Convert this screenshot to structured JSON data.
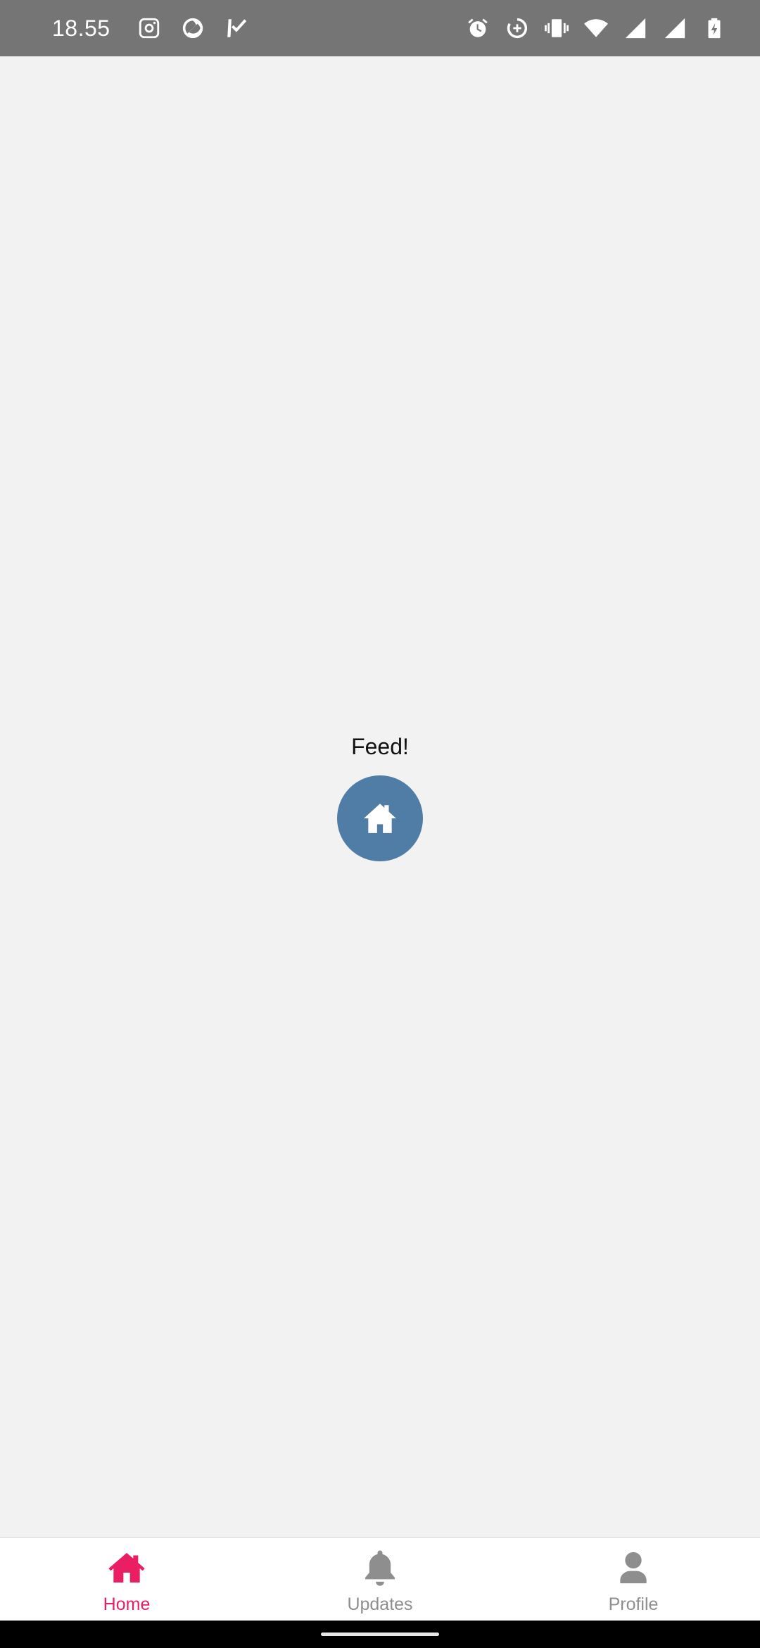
{
  "status_bar": {
    "time": "18.55",
    "left_icons": [
      "instagram-icon",
      "app-q-icon",
      "delivery-check-icon"
    ],
    "right_icons": [
      "alarm-icon",
      "data-saver-icon",
      "vibrate-icon",
      "wifi-icon",
      "signal-icon",
      "signal-icon",
      "battery-charging-icon"
    ]
  },
  "main": {
    "feed_text": "Feed!",
    "fab_icon": "home-icon",
    "fab_color": "#4f7da5"
  },
  "tabs": [
    {
      "label": "Home",
      "icon": "home-icon",
      "active": true
    },
    {
      "label": "Updates",
      "icon": "bell-icon",
      "active": false
    },
    {
      "label": "Profile",
      "icon": "person-icon",
      "active": false
    }
  ],
  "colors": {
    "accent": "#e91e63",
    "inactive": "#8e8e8e",
    "background": "#f2f2f2",
    "status_bar": "#757575"
  }
}
